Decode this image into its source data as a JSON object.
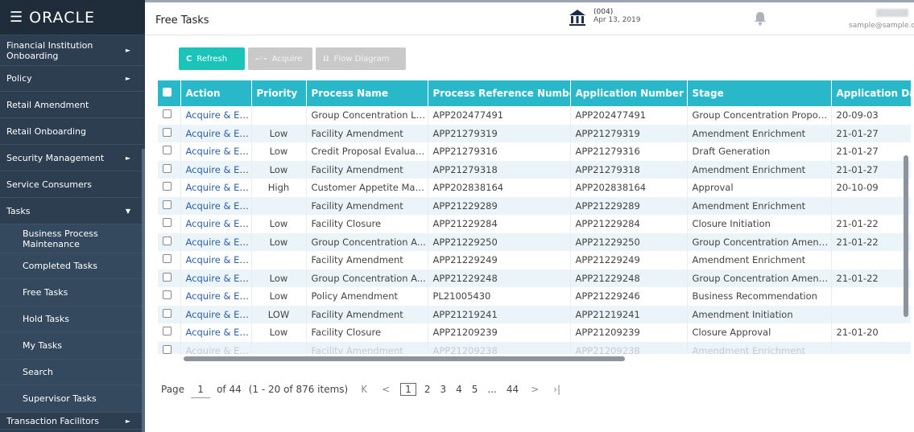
{
  "app": {
    "logo": "ORACLE",
    "page_title": "Free Tasks"
  },
  "header": {
    "branch_code": "(004)",
    "branch_date": "Apr 13, 2019",
    "user_email": "sample@sample.com"
  },
  "sidebar": {
    "items": [
      {
        "label": "Financial Institution Onboarding",
        "arrow": "►",
        "type": "menu"
      },
      {
        "label": "Policy",
        "arrow": "►",
        "type": "menu"
      },
      {
        "label": "Retail Amendment",
        "arrow": "",
        "type": "menu"
      },
      {
        "label": "Retail Onboarding",
        "arrow": "",
        "type": "menu"
      },
      {
        "label": "Security Management",
        "arrow": "►",
        "type": "menu"
      },
      {
        "label": "Service Consumers",
        "arrow": "",
        "type": "menu"
      },
      {
        "label": "Tasks",
        "arrow": "▼",
        "type": "menu"
      },
      {
        "label": "Business Process Maintenance",
        "arrow": "",
        "type": "sub"
      },
      {
        "label": "Completed Tasks",
        "arrow": "",
        "type": "sub"
      },
      {
        "label": "Free Tasks",
        "arrow": "",
        "type": "sub"
      },
      {
        "label": "Hold Tasks",
        "arrow": "",
        "type": "sub"
      },
      {
        "label": "My Tasks",
        "arrow": "",
        "type": "sub"
      },
      {
        "label": "Search",
        "arrow": "",
        "type": "sub"
      },
      {
        "label": "Supervisor Tasks",
        "arrow": "",
        "type": "sub"
      },
      {
        "label": "Transaction Facilitors",
        "arrow": "►",
        "type": "menu"
      }
    ]
  },
  "toolbar": {
    "refresh_label": "Refresh",
    "acquire_label": "Acquire",
    "flow_label": "Flow Diagram"
  },
  "table": {
    "columns": [
      "Action",
      "Priority",
      "Process Name",
      "Process Reference Number",
      "Application Number",
      "Stage",
      "Application Da"
    ],
    "rows": [
      [
        "Acquire & Edit",
        "",
        "Group Concentration Li...",
        "APP202477491",
        "APP202477491",
        "Group Concentration Propos...",
        "20-09-03"
      ],
      [
        "Acquire & Edit",
        "Low",
        "Facility Amendment",
        "APP21279319",
        "APP21279319",
        "Amendment Enrichment",
        "21-01-27"
      ],
      [
        "Acquire & Edit",
        "Low",
        "Credit Proposal Evaluati...",
        "APP21279316",
        "APP21279316",
        "Draft Generation",
        "21-01-27"
      ],
      [
        "Acquire & Edit",
        "Low",
        "Facility Amendment",
        "APP21279318",
        "APP21279318",
        "Amendment Enrichment",
        "21-01-27"
      ],
      [
        "Acquire & Edit",
        "High",
        "Customer Appetite Man...",
        "APP202838164",
        "APP202838164",
        "Approval",
        "20-10-09"
      ],
      [
        "Acquire & Edit",
        "",
        "Facility Amendment",
        "APP21229289",
        "APP21229289",
        "Amendment Enrichment",
        ""
      ],
      [
        "Acquire & Edit",
        "Low",
        "Facility Closure",
        "APP21229284",
        "APP21229284",
        "Closure Initiation",
        "21-01-22"
      ],
      [
        "Acquire & Edit",
        "Low",
        "Group Concentration A...",
        "APP21229250",
        "APP21229250",
        "Group Concentration Amend...",
        "21-01-22"
      ],
      [
        "Acquire & Edit",
        "",
        "Facility Amendment",
        "APP21229249",
        "APP21229249",
        "Amendment Enrichment",
        ""
      ],
      [
        "Acquire & Edit",
        "Low",
        "Group Concentration A...",
        "APP21229248",
        "APP21229248",
        "Group Concentration Amend...",
        "21-01-22"
      ],
      [
        "Acquire & Edit",
        "Low",
        "Policy Amendment",
        "PL21005430",
        "APP21229246",
        "Business Recommendation",
        ""
      ],
      [
        "Acquire & Edit",
        "LOW",
        "Facility Amendment",
        "APP21219241",
        "APP21219241",
        "Amendment Initiation",
        ""
      ],
      [
        "Acquire & Edit",
        "Low",
        "Facility Closure",
        "APP21209239",
        "APP21209239",
        "Closure Approval",
        "21-01-20"
      ],
      [
        "Acquire & Edit",
        "",
        "Facility Amendment",
        "APP21209238",
        "APP21209238",
        "Amendment Enrichment",
        ""
      ]
    ]
  },
  "pager": {
    "page_label": "Page",
    "current_page": "1",
    "of_label": "of 44",
    "items_label": "(1 - 20 of 876 items)",
    "first": "K",
    "prev": "<",
    "pages": [
      "1",
      "2",
      "3",
      "4",
      "5",
      "...",
      "44"
    ],
    "next": ">",
    "last": "›|"
  }
}
